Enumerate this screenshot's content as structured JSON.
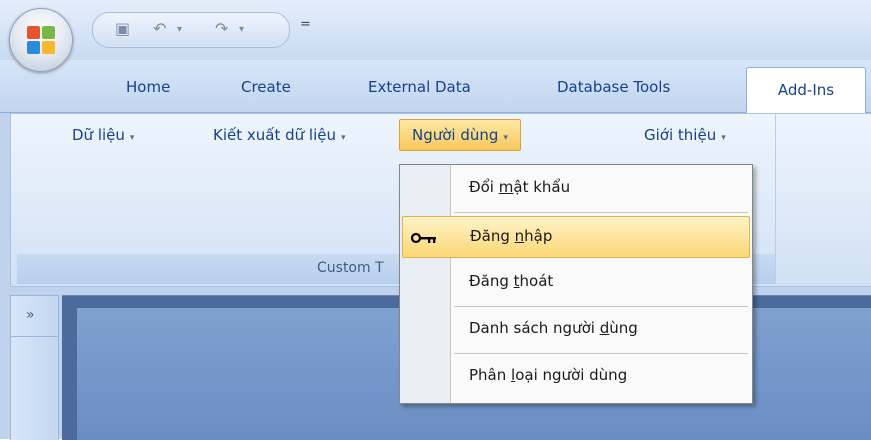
{
  "tabs": [
    "Home",
    "Create",
    "External Data",
    "Database Tools",
    "Add-Ins"
  ],
  "active_tab": "Add-Ins",
  "qat": {
    "save_icon": "save-icon",
    "undo_icon": "undo-icon",
    "redo_icon": "redo-icon",
    "customize": "="
  },
  "ribbon": {
    "buttons": [
      "Dữ liệu",
      "Kiết xuất dữ liệu",
      "Người dùng",
      "Giới thiệu"
    ],
    "group_title": "Custom T",
    "arrow": "▾"
  },
  "sidebar": {
    "toggle": "»"
  },
  "menu": {
    "items": [
      {
        "pre": "Đổi ",
        "acc": "m",
        "post": "ật khẩu"
      },
      {
        "pre": "Đăng ",
        "acc": "n",
        "post": "hập",
        "icon": "key-icon"
      },
      {
        "pre": "Đăng ",
        "acc": "t",
        "post": "hoát"
      },
      {
        "pre": "Danh sách người ",
        "acc": "d",
        "post": "ùng"
      },
      {
        "pre": "Phân ",
        "acc": "l",
        "post": "oại người dùng"
      }
    ],
    "highlighted_index": 1
  }
}
